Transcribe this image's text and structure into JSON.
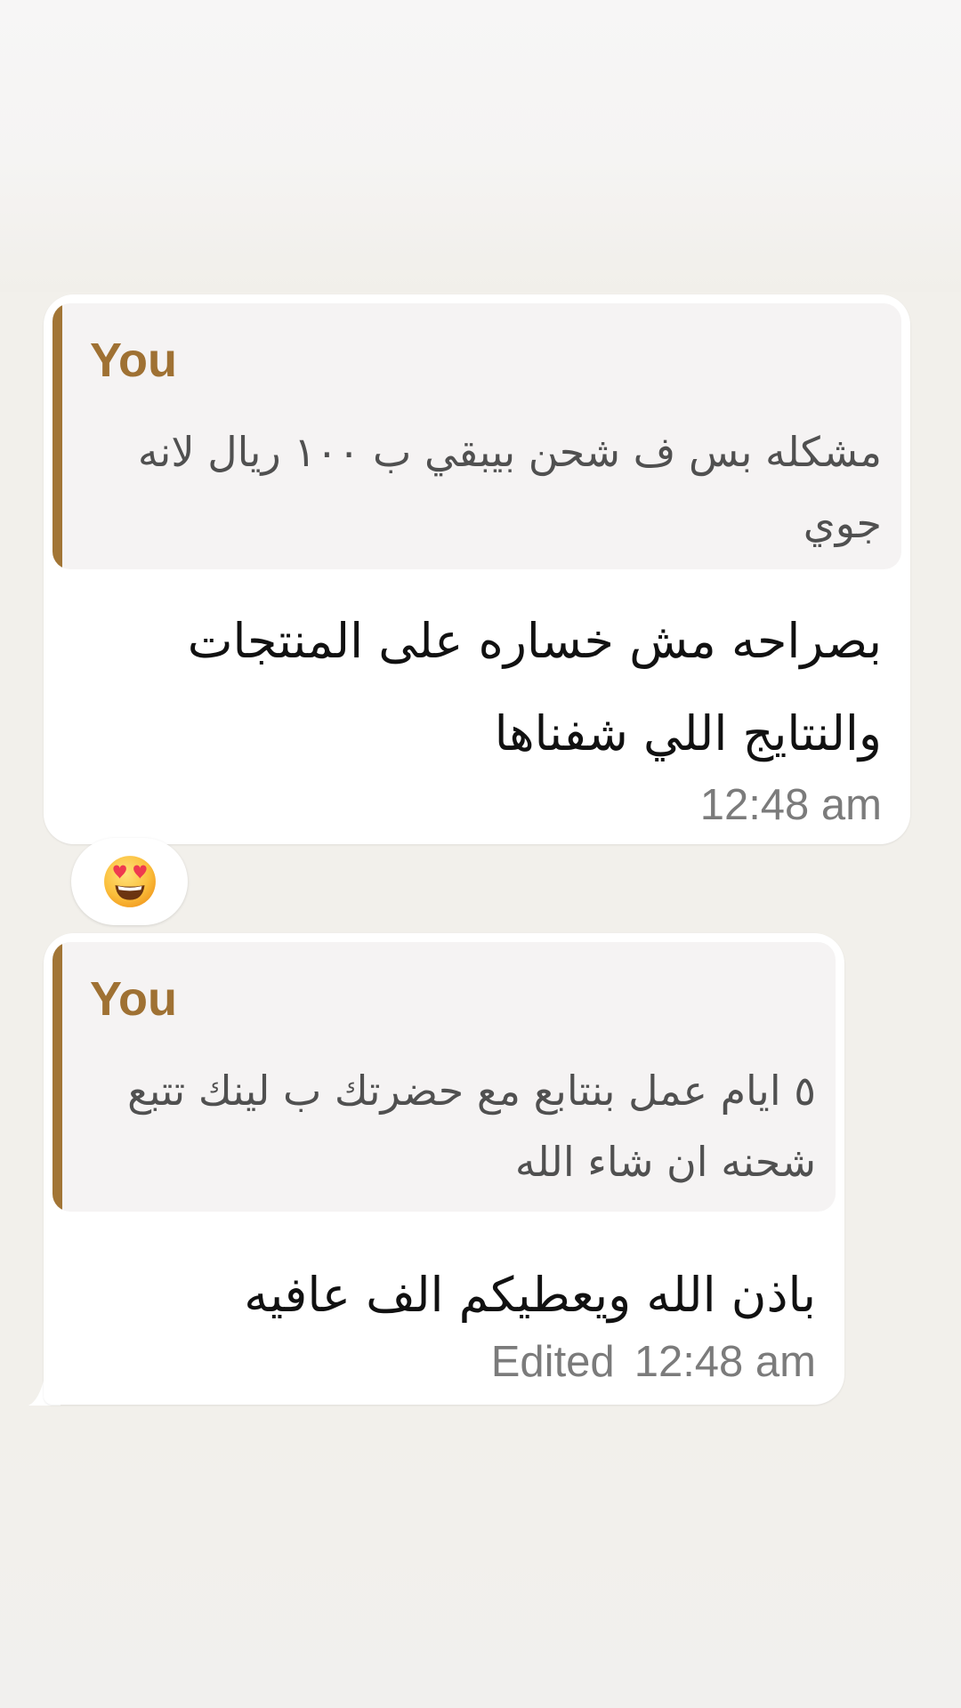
{
  "messages": [
    {
      "quote": {
        "author": "You",
        "text": "مشكله بس ف شحن بيبقي ب ١٠٠ ريال لانه جوي"
      },
      "text": "بصراحه مش خساره على المنتجات والنتايج اللي شفناها",
      "time": "12:48 am",
      "reaction": "heart-eyes-emoji"
    },
    {
      "quote": {
        "author": "You",
        "text": "٥ ايام عمل بنتابع مع حضرتك ب لينك تتبع شحنه ان شاء الله"
      },
      "text": "باذن الله ويعطيكم الف عافيه",
      "edited_label": "Edited",
      "time": "12:48 am"
    }
  ],
  "colors": {
    "chat_background": "#f2f0eb",
    "bubble": "#ffffff",
    "quote_background": "#f5f3f3",
    "quote_accent": "#a27535",
    "quote_author": "#9f7133",
    "timestamp": "#7b7b7b"
  }
}
